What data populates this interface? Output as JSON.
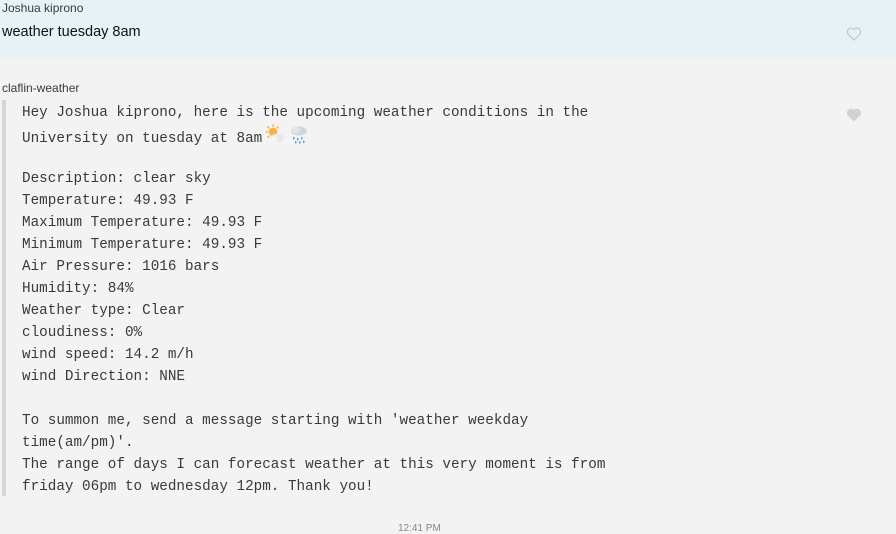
{
  "user_message": {
    "sender": "Joshua kiprono",
    "text": "weather tuesday 8am",
    "like_icon": "heart-outline-icon"
  },
  "bot_message": {
    "sender": "claflin-weather",
    "intro_line1": "Hey Joshua kiprono, here is the upcoming weather conditions in the",
    "intro_line2": "University on tuesday at 8am",
    "emojis": [
      "sun-behind-cloud-icon",
      "cloud-with-rain-icon"
    ],
    "details": [
      "Description: clear sky",
      "Temperature: 49.93 F",
      "Maximum Temperature: 49.93 F",
      "Minimum Temperature: 49.93 F",
      "Air Pressure: 1016 bars",
      "Humidity: 84%",
      "Weather type: Clear",
      "cloudiness: 0%",
      "wind speed: 14.2 m/h",
      "wind Direction: NNE"
    ],
    "footer": [
      "To summon me, send a message starting with 'weather weekday",
      "time(am/pm)'.",
      "The range of days I can forecast weather at this very moment is from",
      "friday 06pm to wednesday 12pm. Thank you!"
    ],
    "like_icon": "heart-filled-icon"
  },
  "timestamp": "12:41 PM",
  "colors": {
    "user_bg": "#e6f2f5",
    "bot_bg": "#f3f3f3",
    "accent_bar": "#d6d6d6"
  }
}
